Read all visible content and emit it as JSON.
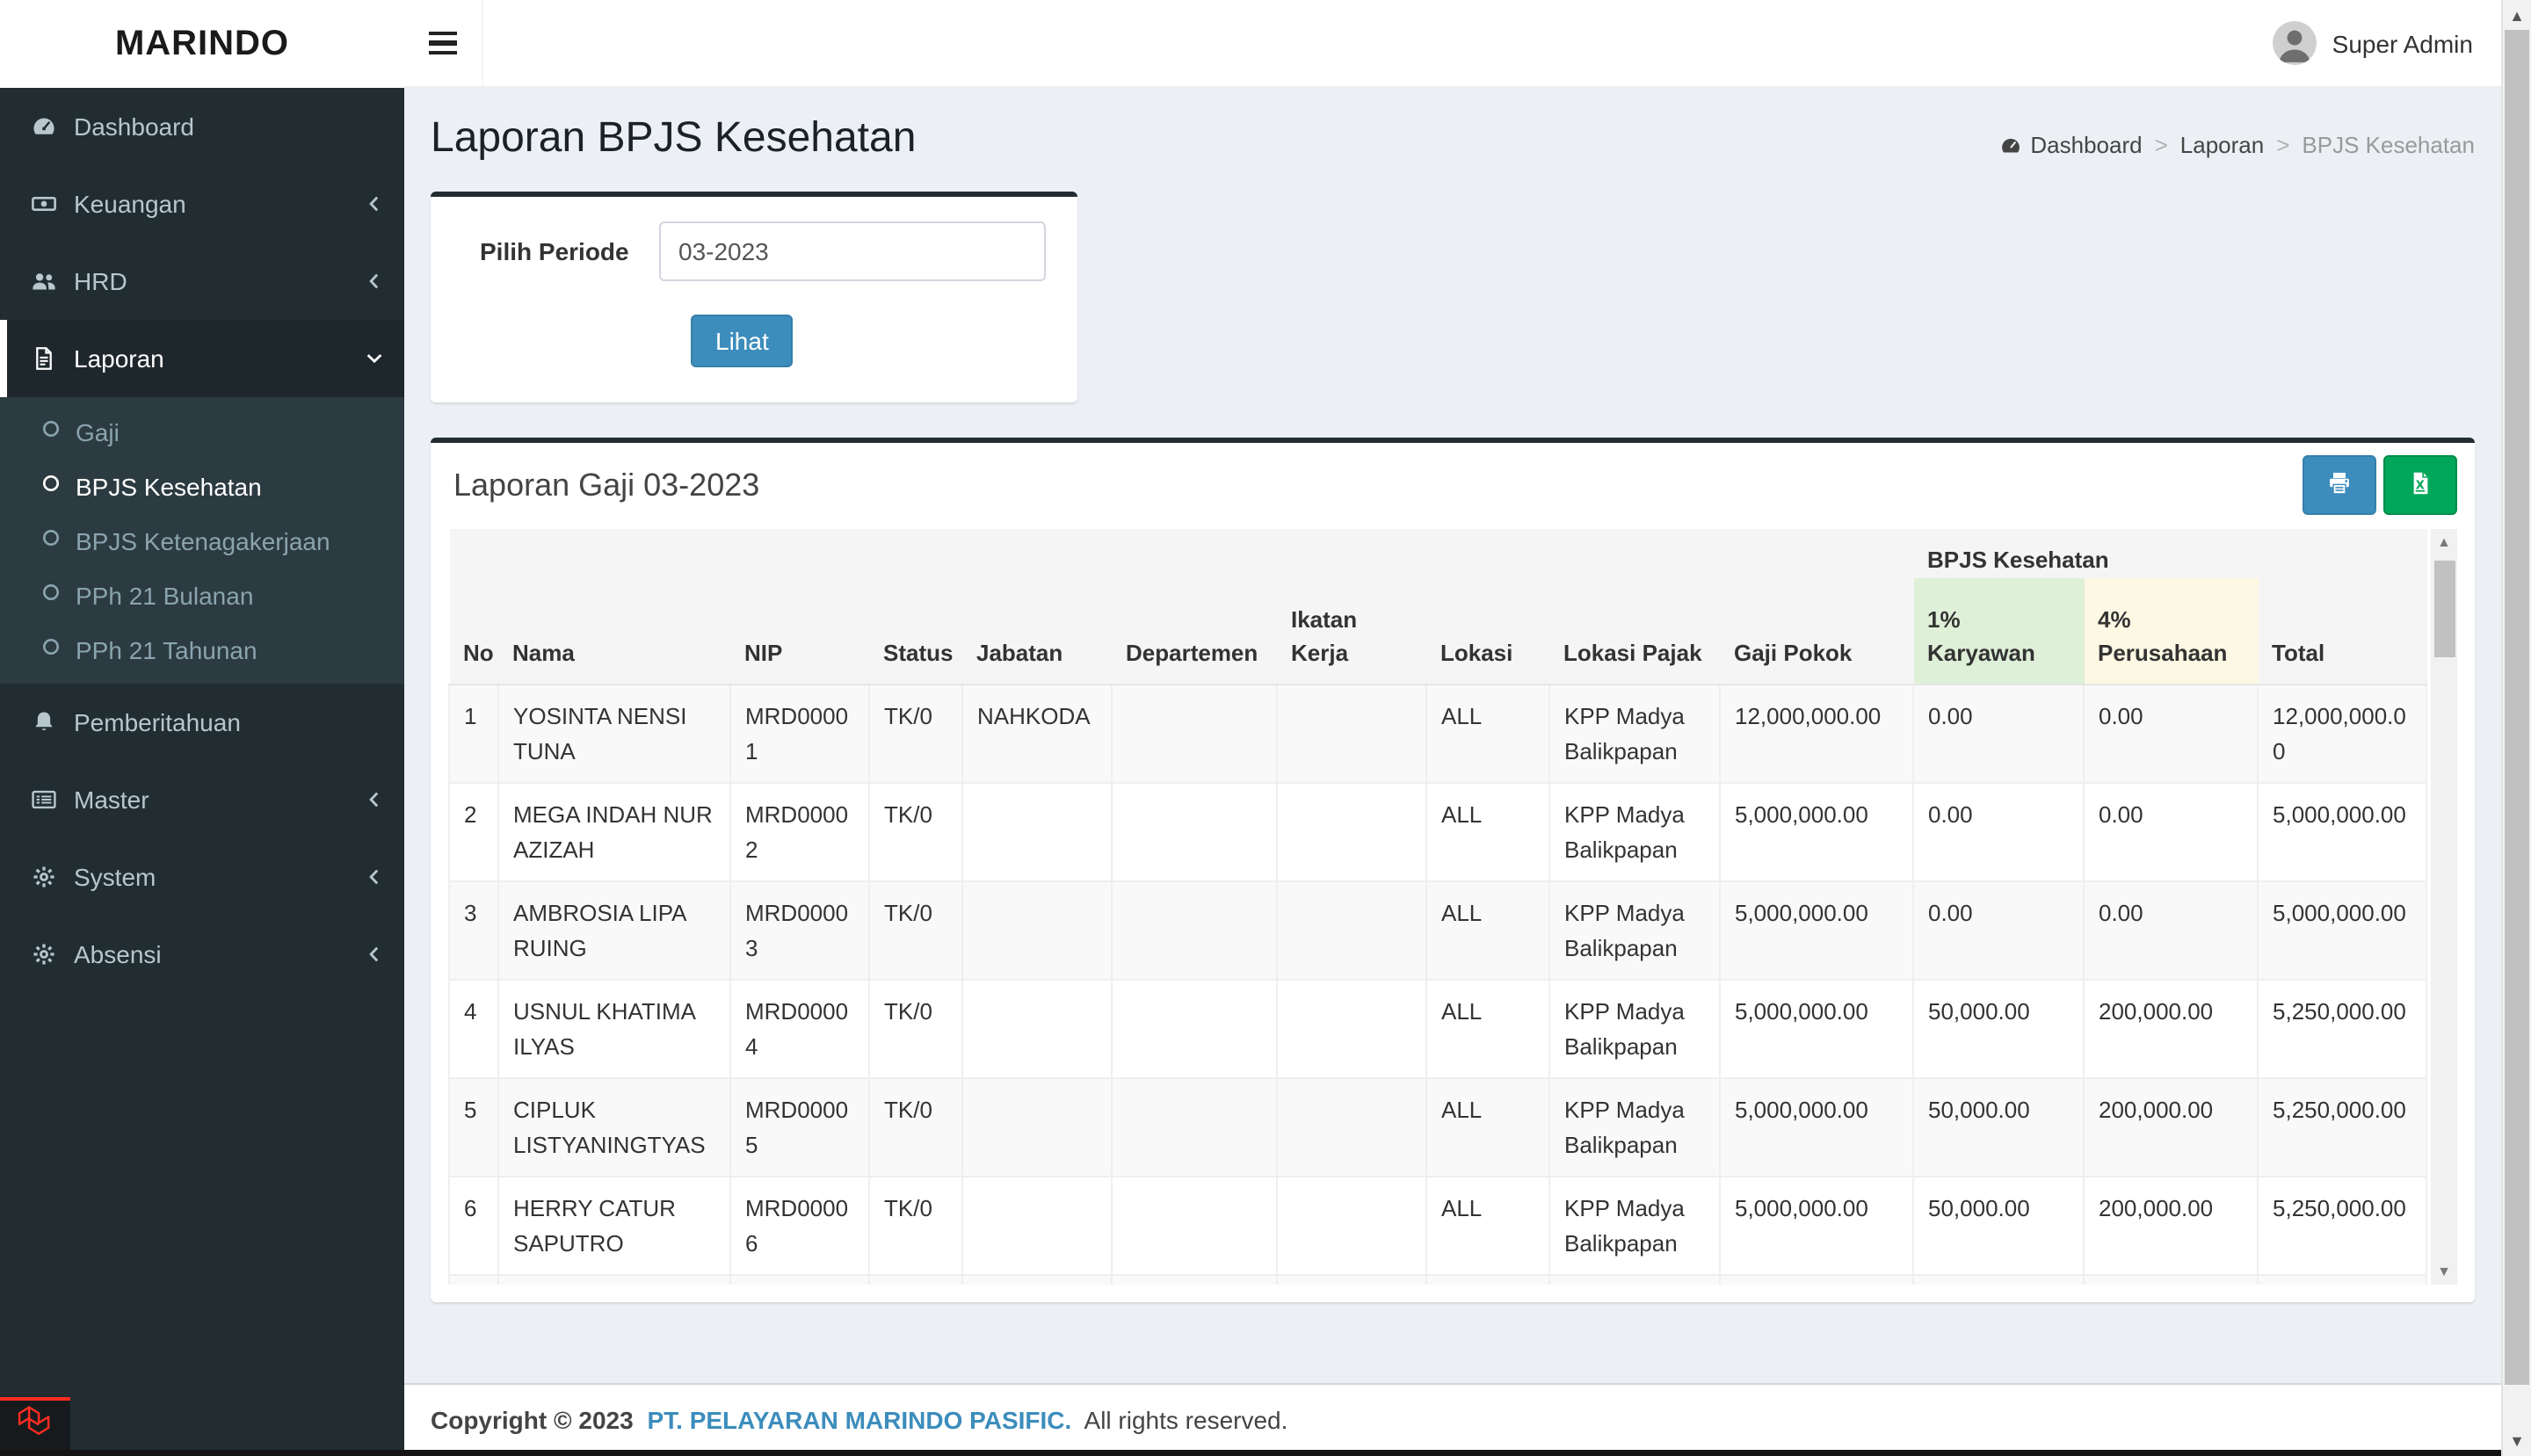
{
  "brand": {
    "logo_text": "MARINDO"
  },
  "topbar": {
    "user_name": "Super Admin",
    "menu_icon": "hamburger-icon",
    "avatar_icon": "avatar"
  },
  "sidebar": {
    "items": [
      {
        "label": "Dashboard",
        "icon": "dashboard-icon",
        "chevron": null,
        "active": false
      },
      {
        "label": "Keuangan",
        "icon": "money-icon",
        "chevron": "left",
        "active": false
      },
      {
        "label": "HRD",
        "icon": "users-icon",
        "chevron": "left",
        "active": false
      },
      {
        "label": "Laporan",
        "icon": "file-icon",
        "chevron": "down",
        "active": true,
        "submenu": [
          {
            "label": "Gaji",
            "active": false
          },
          {
            "label": "BPJS Kesehatan",
            "active": true
          },
          {
            "label": "BPJS Ketenagakerjaan",
            "active": false
          },
          {
            "label": "PPh 21 Bulanan",
            "active": false
          },
          {
            "label": "PPh 21 Tahunan",
            "active": false
          }
        ]
      },
      {
        "label": "Pemberitahuan",
        "icon": "bell-icon",
        "chevron": null,
        "active": false
      },
      {
        "label": "Master",
        "icon": "list-icon",
        "chevron": "left",
        "active": false
      },
      {
        "label": "System",
        "icon": "gear-icon",
        "chevron": "left",
        "active": false
      },
      {
        "label": "Absensi",
        "icon": "gear-icon",
        "chevron": "left",
        "active": false
      }
    ]
  },
  "page": {
    "title": "Laporan BPJS Kesehatan",
    "breadcrumb": [
      {
        "label": "Dashboard",
        "icon": "dashboard-icon",
        "current": false
      },
      {
        "label": "Laporan",
        "current": false
      },
      {
        "label": "BPJS Kesehatan",
        "current": true
      }
    ]
  },
  "filter_card": {
    "label": "Pilih Periode",
    "period_value": "03-2023",
    "submit_label": "Lihat"
  },
  "report_card": {
    "title": "Laporan Gaji 03-2023",
    "tools": [
      {
        "name": "print",
        "icon": "printer-icon"
      },
      {
        "name": "excel",
        "icon": "excel-icon"
      }
    ],
    "table": {
      "group_header": {
        "label": "BPJS Kesehatan",
        "spans": [
          "1% Karyawan",
          "4% Perusahaan"
        ]
      },
      "columns": [
        {
          "label": "No"
        },
        {
          "label": "Nama"
        },
        {
          "label": "NIP"
        },
        {
          "label": "Status"
        },
        {
          "label": "Jabatan"
        },
        {
          "label": "Departemen"
        },
        {
          "label": "Ikatan Kerja"
        },
        {
          "label": "Lokasi"
        },
        {
          "label": "Lokasi Pajak"
        },
        {
          "label": "Gaji Pokok"
        },
        {
          "label": "1% Karyawan",
          "highlight": "green"
        },
        {
          "label": "4% Perusahaan",
          "highlight": "yellow"
        },
        {
          "label": "Total"
        }
      ],
      "rows": [
        [
          "1",
          "YOSINTA NENSI TUNA",
          "MRD00001",
          "TK/0",
          "NAHKODA",
          "",
          "",
          "ALL",
          "KPP Madya Balikpapan",
          "12,000,000.00",
          "0.00",
          "0.00",
          "12,000,000.00"
        ],
        [
          "2",
          "MEGA INDAH NUR AZIZAH",
          "MRD00002",
          "TK/0",
          "",
          "",
          "",
          "ALL",
          "KPP Madya Balikpapan",
          "5,000,000.00",
          "0.00",
          "0.00",
          "5,000,000.00"
        ],
        [
          "3",
          "AMBROSIA LIPA RUING",
          "MRD00003",
          "TK/0",
          "",
          "",
          "",
          "ALL",
          "KPP Madya Balikpapan",
          "5,000,000.00",
          "0.00",
          "0.00",
          "5,000,000.00"
        ],
        [
          "4",
          "USNUL KHATIMA ILYAS",
          "MRD00004",
          "TK/0",
          "",
          "",
          "",
          "ALL",
          "KPP Madya Balikpapan",
          "5,000,000.00",
          "50,000.00",
          "200,000.00",
          "5,250,000.00"
        ],
        [
          "5",
          "CIPLUK LISTYANINGTYAS",
          "MRD00005",
          "TK/0",
          "",
          "",
          "",
          "ALL",
          "KPP Madya Balikpapan",
          "5,000,000.00",
          "50,000.00",
          "200,000.00",
          "5,250,000.00"
        ],
        [
          "6",
          "HERRY CATUR SAPUTRO",
          "MRD00006",
          "TK/0",
          "",
          "",
          "",
          "ALL",
          "KPP Madya Balikpapan",
          "5,000,000.00",
          "50,000.00",
          "200,000.00",
          "5,250,000.00"
        ]
      ]
    }
  },
  "footer": {
    "copyright_prefix": "Copyright © 2023",
    "company": "PT. PELAYARAN MARINDO PASIFIC.",
    "suffix": "All rights reserved."
  },
  "colors": {
    "sidebar": "#222d32",
    "sidebar_active": "#1e282c",
    "submenu": "#2c3b41",
    "accent_blue": "#3c8dbc",
    "button_green": "#00a65a",
    "success_bg": "#dff0d8",
    "warning_bg": "#fcf8e3",
    "laravel_red": "#ff2d20",
    "content_bg": "#ecf0f5"
  }
}
